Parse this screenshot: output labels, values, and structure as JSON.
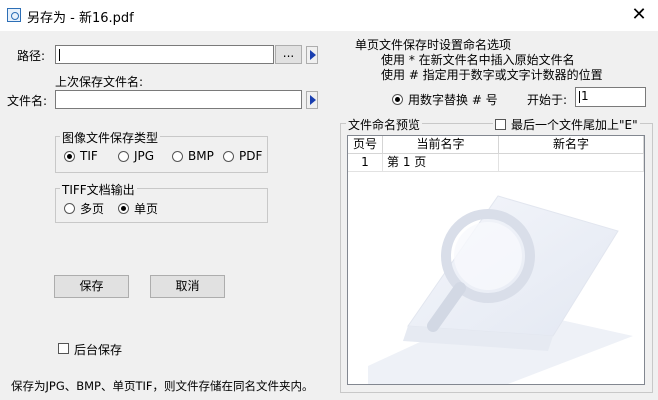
{
  "window": {
    "title": "另存为 - 新16.pdf",
    "close_glyph": "✕"
  },
  "path": {
    "label": "路径:",
    "value": "",
    "browse_label": "..."
  },
  "last_saved": {
    "label": "上次保存文件名:"
  },
  "filename": {
    "label": "文件名:",
    "value": ""
  },
  "image_type": {
    "legend": "图像文件保存类型",
    "options": [
      {
        "label": "TIF",
        "selected": true
      },
      {
        "label": "JPG",
        "selected": false
      },
      {
        "label": "BMP",
        "selected": false
      },
      {
        "label": "PDF",
        "selected": false
      }
    ]
  },
  "tiff_output": {
    "legend": "TIFF文档输出",
    "options": [
      {
        "label": "多页",
        "selected": false
      },
      {
        "label": "单页",
        "selected": true
      }
    ]
  },
  "buttons": {
    "save": "保存",
    "cancel": "取消"
  },
  "background_save": {
    "label": "后台保存",
    "checked": false
  },
  "footnote": "保存为JPG、BMP、单页TIF，则文件存储在同名文件夹内。",
  "naming": {
    "title": "单页文件保存时设置命名选项",
    "hint1": "使用 * 在新文件名中插入原始文件名",
    "hint2": "使用 # 指定用于数字或文字计数器的位置",
    "replace_label": "用数字替换 # 号",
    "replace_selected": true,
    "start_label": "开始于:",
    "start_value": "1"
  },
  "preview": {
    "title": "文件命名预览",
    "last_file_e_label": "最后一个文件尾加上\"E\"",
    "last_file_e_checked": false,
    "columns": [
      "页号",
      "当前名字",
      "新名字"
    ],
    "rows": [
      {
        "page": "1",
        "current": "第 1 页",
        "new": ""
      }
    ]
  }
}
